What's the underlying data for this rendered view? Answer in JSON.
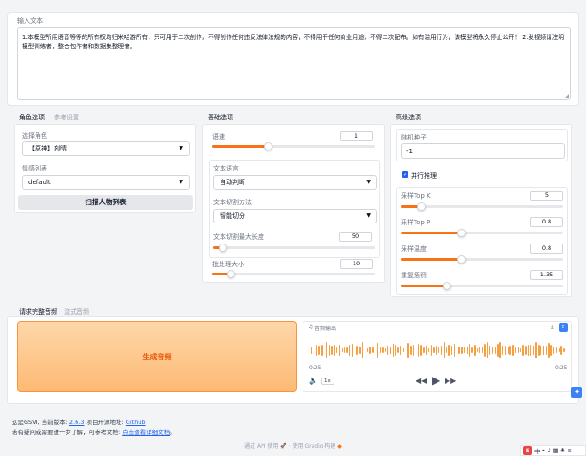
{
  "input": {
    "label": "输入文本",
    "text": "1.本模型所用语音等等的所有权均归米哈游所有，只可用于二次创作，不得创作任何违反法律法规的内容，不得用于任何商业用途，不得二次配布。如有滥用行为，该模型将永久停止公开！ 2.发视频请注明模型训练者，整合包作者和数据集整理者。"
  },
  "role_panel": {
    "tabs": [
      "角色选项",
      "参考设置"
    ],
    "character_label": "选择角色",
    "character_value": "【原神】刻晴",
    "emotion_label": "情感列表",
    "emotion_value": "default",
    "scan_button": "扫描人物列表"
  },
  "basic_panel": {
    "title": "基础选项",
    "speed_label": "语速",
    "speed_value": "1",
    "language_label": "文本语言",
    "language_value": "自动判断",
    "cut_label": "文本切割方法",
    "cut_value": "智能切分",
    "max_len_label": "文本切割最大长度",
    "max_len_value": "50",
    "batch_label": "批处理大小",
    "batch_value": "10"
  },
  "advanced_panel": {
    "title": "高级选项",
    "seed_label": "随机种子",
    "seed_value": "-1",
    "parallel_label": "并行推理",
    "topk_label": "采样Top K",
    "topk_value": "5",
    "topp_label": "采样Top P",
    "topp_value": "0.8",
    "temp_label": "采样温度",
    "temp_value": "0.8",
    "penalty_label": "重复惩罚",
    "penalty_value": "1.35"
  },
  "output_panel": {
    "tabs": [
      "请求完整音频",
      "流式音频"
    ],
    "generate_button": "生成音频",
    "audio_label": "音频输出",
    "time_start": "0:25",
    "time_end": "0:25",
    "speed_badge": "1x"
  },
  "footer": {
    "line1_prefix": "这是GSVI, 当前版本: ",
    "version": "2.6.3",
    "line1_mid": " 项目开源地址: ",
    "github": "Github",
    "line2_prefix": "若有疑问或需要进一步了解，可参考文档: ",
    "doc_link": "点击查看详细文档",
    "line2_suffix": "。",
    "api": "通过 API 使用",
    "dot": "·",
    "built": "使用 Gradio 构建"
  },
  "colors": {
    "accent": "#f97316",
    "wave": "#f59e42",
    "button_bg": "#fdba74",
    "link": "#2563eb"
  }
}
